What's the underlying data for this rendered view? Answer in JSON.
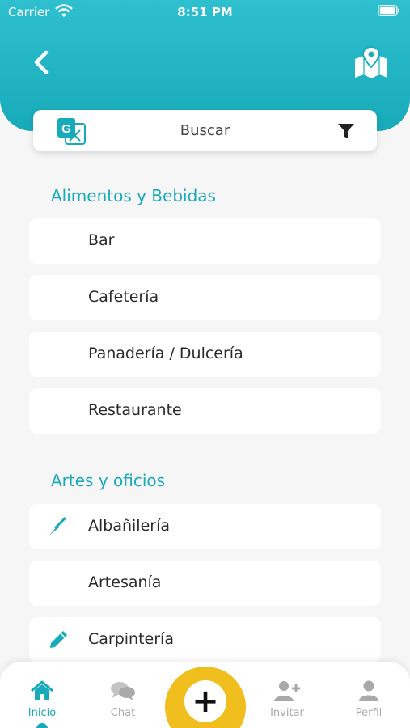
{
  "status_bar": {
    "carrier": "Carrier",
    "time": "8:51 PM"
  },
  "search": {
    "label": "Buscar"
  },
  "sections": [
    {
      "title": "Alimentos y Bebidas",
      "items": [
        {
          "label": "Bar",
          "icon": ""
        },
        {
          "label": "Cafetería",
          "icon": ""
        },
        {
          "label": "Panadería / Dulcería",
          "icon": ""
        },
        {
          "label": "Restaurante",
          "icon": ""
        }
      ]
    },
    {
      "title": "Artes y oficios",
      "items": [
        {
          "label": "Albañilería",
          "icon": "trowel-icon"
        },
        {
          "label": "Artesanía",
          "icon": ""
        },
        {
          "label": "Carpintería",
          "icon": "pencil-icon"
        }
      ]
    }
  ],
  "nav": {
    "items": [
      {
        "label": "Inicio",
        "icon": "home-icon",
        "active": true
      },
      {
        "label": "Chat",
        "icon": "chat-icon"
      },
      {
        "label": "Invitar",
        "icon": "add-user-icon"
      },
      {
        "label": "Perfil",
        "icon": "user-icon"
      }
    ],
    "fab_symbol": "+"
  },
  "colors": {
    "primary": "#17aab8",
    "accent": "#f0bf1e",
    "background": "#f6f6f6"
  }
}
